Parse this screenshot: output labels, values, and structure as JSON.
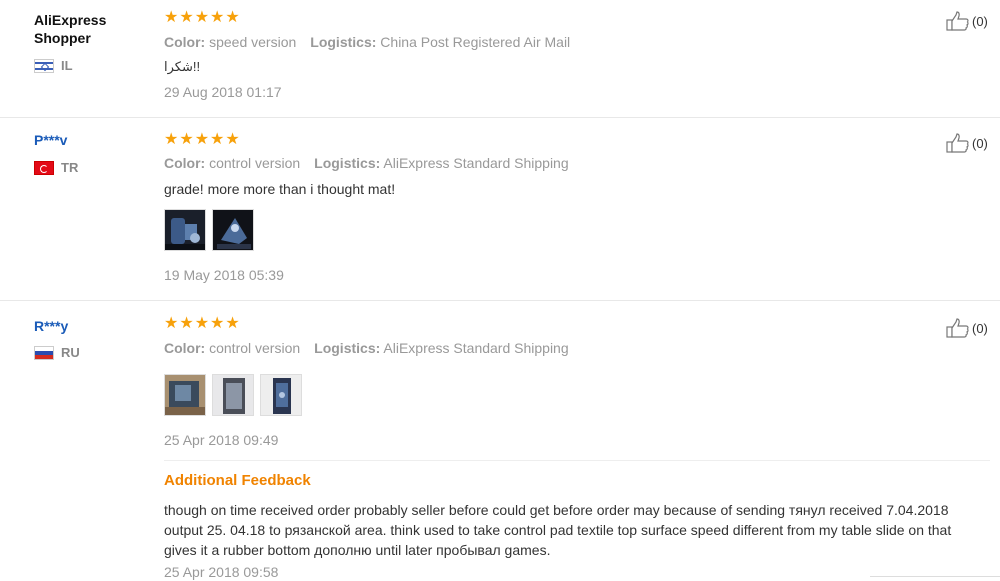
{
  "labels": {
    "color": "Color:",
    "logistics": "Logistics:",
    "additional_feedback": "Additional Feedback"
  },
  "reviews": [
    {
      "user": "AliExpress Shopper",
      "country": "IL",
      "rating": 5,
      "stars": "★★★★★",
      "color_value": "speed version",
      "logistics_value": "China Post Registered Air Mail",
      "text": "شكرا!!",
      "date": "29 Aug 2018 01:17",
      "helpful_count": "(0)"
    },
    {
      "user": "P***v",
      "country": "TR",
      "rating": 5,
      "stars": "★★★★★",
      "color_value": "control version",
      "logistics_value": "AliExpress Standard Shipping",
      "text": "grade! more more than i thought mat!",
      "date": "19 May 2018 05:39",
      "helpful_count": "(0)"
    },
    {
      "user": "R***y",
      "country": "RU",
      "rating": 5,
      "stars": "★★★★★",
      "color_value": "control version",
      "logistics_value": "AliExpress Standard Shipping",
      "date": "25 Apr 2018 09:49",
      "helpful_count": "(0)",
      "additional_text": "though on time received order probably seller before could get before order may because of sending тянул received 7.04.2018 output 25. 04.18 to рязанской area. think used to take control pad textile top surface speed different from my table slide on that gives it a rubber bottom дополню until later пробывал games.",
      "additional_date": "25 Apr 2018 09:58"
    }
  ],
  "colors": {
    "star": "#f7a10b",
    "link": "#1a5bb8",
    "accent": "#f08300",
    "muted": "#999999"
  }
}
